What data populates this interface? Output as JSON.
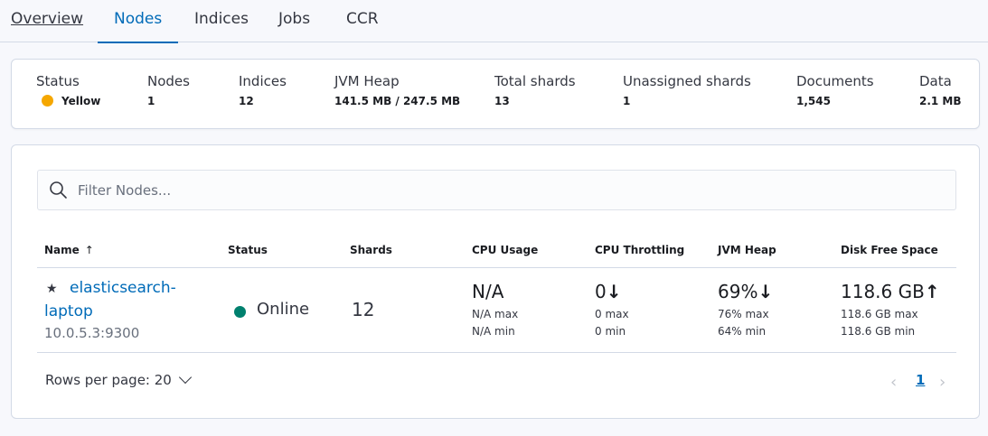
{
  "tabs": [
    {
      "label": "Overview"
    },
    {
      "label": "Nodes"
    },
    {
      "label": "Indices"
    },
    {
      "label": "Jobs"
    },
    {
      "label": "CCR"
    }
  ],
  "summary": {
    "status": {
      "label": "Status",
      "value": "Yellow",
      "color": "#f5a700"
    },
    "nodes": {
      "label": "Nodes",
      "value": "1"
    },
    "indices": {
      "label": "Indices",
      "value": "12"
    },
    "jvm_heap": {
      "label": "JVM Heap",
      "value": "141.5 MB / 247.5 MB"
    },
    "total_shards": {
      "label": "Total shards",
      "value": "13"
    },
    "unassigned_shards": {
      "label": "Unassigned shards",
      "value": "1"
    },
    "documents": {
      "label": "Documents",
      "value": "1,545"
    },
    "data": {
      "label": "Data",
      "value": "2.1 MB"
    }
  },
  "search": {
    "placeholder": "Filter Nodes...",
    "icon": "search-icon"
  },
  "table": {
    "headers": {
      "name": "Name",
      "status": "Status",
      "shards": "Shards",
      "cpu_usage": "CPU Usage",
      "cpu_throttling": "CPU Throttling",
      "jvm_heap": "JVM Heap",
      "disk_free": "Disk Free Space"
    },
    "rows": [
      {
        "name": "elasticsearch-laptop",
        "address": "10.0.5.3:9300",
        "status": "Online",
        "status_color": "#00806e",
        "shards": "12",
        "cpu_usage": {
          "current": "N/A",
          "max": "N/A max",
          "min": "N/A min"
        },
        "cpu_throttling": {
          "current": "0",
          "trend": "↓",
          "max": "0 max",
          "min": "0 min"
        },
        "jvm_heap": {
          "current": "69%",
          "trend": "↓",
          "max": "76% max",
          "min": "64% min"
        },
        "disk_free": {
          "current": "118.6 GB",
          "trend": "↑",
          "max": "118.6 GB max",
          "min": "118.6 GB min"
        }
      }
    ]
  },
  "pagination": {
    "rows_per_page": "Rows per page: 20",
    "current_page": "1",
    "prev": "‹",
    "next": "›"
  }
}
